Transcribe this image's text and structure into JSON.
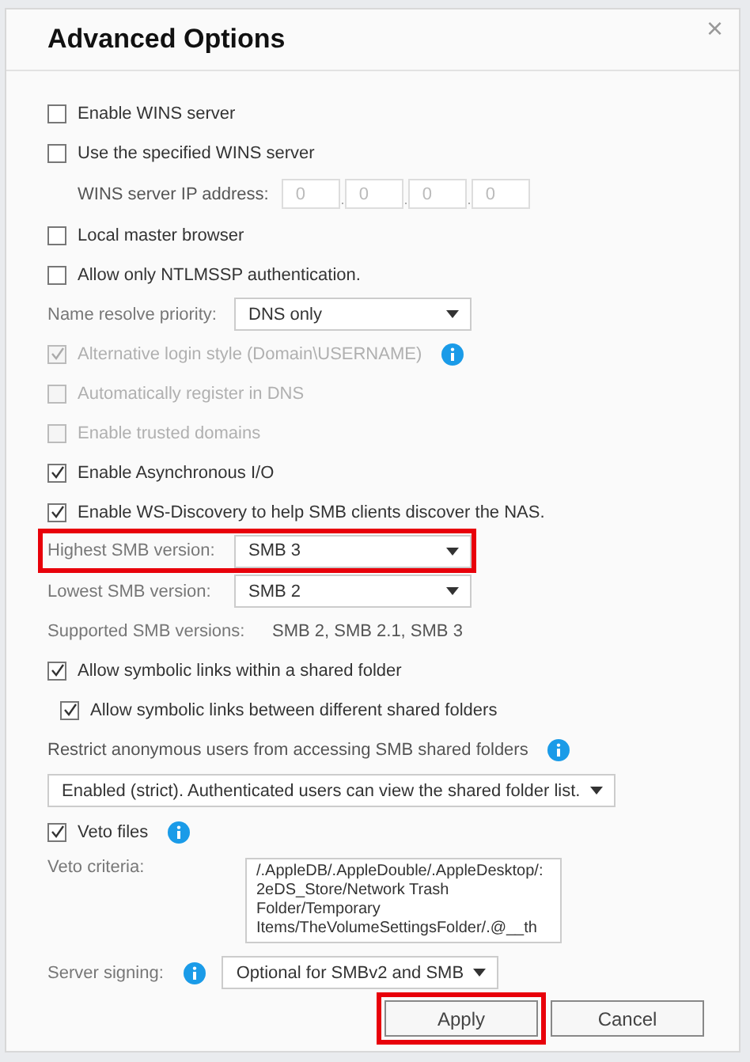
{
  "dialog": {
    "title": "Advanced Options",
    "close": "×"
  },
  "rows": [
    {
      "kind": "checkbox",
      "label": "Enable WINS server",
      "checked": false,
      "disabled": false,
      "indented": false
    },
    {
      "kind": "checkbox",
      "label": "Use the specified WINS server",
      "checked": false,
      "disabled": false,
      "indented": false
    },
    {
      "kind": "ip",
      "label": "WINS server IP address:",
      "octets": [
        "0",
        "0",
        "0",
        "0"
      ]
    },
    {
      "kind": "checkbox",
      "label": "Local master browser",
      "checked": false,
      "disabled": false,
      "indented": false
    },
    {
      "kind": "checkbox",
      "label": "Allow only NTLMSSP authentication.",
      "checked": false,
      "disabled": false,
      "indented": false
    },
    {
      "kind": "select",
      "label": "Name resolve priority:",
      "value": "DNS only",
      "highlighted": false,
      "info": false
    },
    {
      "kind": "checkbox",
      "label": "Alternative login style (Domain\\USERNAME)",
      "checked": true,
      "disabled": true,
      "indented": false,
      "info": true
    },
    {
      "kind": "checkbox",
      "label": "Automatically register in DNS",
      "checked": false,
      "disabled": true,
      "indented": false
    },
    {
      "kind": "checkbox",
      "label": "Enable trusted domains",
      "checked": false,
      "disabled": true,
      "indented": false
    },
    {
      "kind": "checkbox",
      "label": "Enable Asynchronous I/O",
      "checked": true,
      "disabled": false,
      "indented": false
    },
    {
      "kind": "checkbox",
      "label": "Enable WS-Discovery to help SMB clients discover the NAS.",
      "checked": true,
      "disabled": false,
      "indented": false
    },
    {
      "kind": "select",
      "label": "Highest SMB version:",
      "value": "SMB 3",
      "highlighted": true,
      "info": false
    },
    {
      "kind": "select",
      "label": "Lowest SMB version:",
      "value": "SMB 2",
      "highlighted": false,
      "info": false
    },
    {
      "kind": "info",
      "label": "Supported SMB versions:",
      "value": "SMB 2, SMB 2.1, SMB 3"
    },
    {
      "kind": "checkbox",
      "label": "Allow symbolic links within a shared folder",
      "checked": true,
      "disabled": false,
      "indented": false
    },
    {
      "kind": "checkbox",
      "label": "Allow symbolic links between different shared folders",
      "checked": true,
      "disabled": false,
      "indented": true
    },
    {
      "kind": "heading",
      "label": "Restrict anonymous users from accessing SMB shared folders",
      "info": true
    },
    {
      "kind": "wideselect",
      "value": "Enabled (strict). Authenticated users can view the shared folder list."
    },
    {
      "kind": "checkbox",
      "label": "Veto files",
      "checked": true,
      "disabled": false,
      "indented": false,
      "info": true
    },
    {
      "kind": "textarea",
      "label": "Veto criteria:",
      "lines": [
        "/.AppleDB/.AppleDouble/.AppleDesktop/:",
        "2eDS_Store/Network Trash",
        "Folder/Temporary",
        "Items/TheVolumeSettingsFolder/.@__th"
      ]
    },
    {
      "kind": "select",
      "label": "Server signing:",
      "value": "Optional for SMBv2 and SMB",
      "highlighted": false,
      "info": true
    }
  ],
  "buttons": [
    {
      "label": "Apply",
      "highlighted": true
    },
    {
      "label": "Cancel",
      "highlighted": false
    }
  ]
}
